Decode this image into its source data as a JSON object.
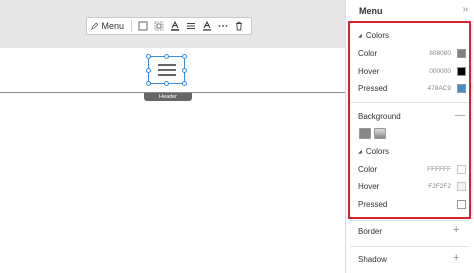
{
  "toolbar": {
    "menu_label": "Menu",
    "icons": [
      "pencil-icon",
      "border-icon",
      "padding-icon",
      "text-color-icon",
      "align-icon",
      "font-color-icon",
      "more-icon",
      "trash-icon"
    ]
  },
  "canvas": {
    "widget_tag": "Header"
  },
  "panel": {
    "title": "Menu",
    "collapse_glyph": "»",
    "text_colors": {
      "title": "Colors",
      "rows": [
        {
          "label": "Color",
          "value": "808080",
          "swatch": "#808080"
        },
        {
          "label": "Hover",
          "value": "000000",
          "swatch": "#000000"
        },
        {
          "label": "Pressed",
          "value": "478AC9",
          "swatch": "#478AC9"
        }
      ]
    },
    "background": {
      "title": "Background",
      "toggle": "—",
      "colors_title": "Colors",
      "rows": [
        {
          "label": "Color",
          "value": "FFFFFF",
          "swatch": "#FFFFFF"
        },
        {
          "label": "Hover",
          "value": "F2F2F2",
          "swatch": "#F2F2F2"
        },
        {
          "label": "Pressed",
          "value": "",
          "swatch": "#FFFFFF"
        }
      ]
    },
    "border": {
      "title": "Border",
      "toggle": "+"
    },
    "shadow": {
      "title": "Shadow",
      "toggle": "+"
    }
  },
  "colors": {
    "highlight": "#d9232d",
    "selection": "#3b8de0"
  }
}
